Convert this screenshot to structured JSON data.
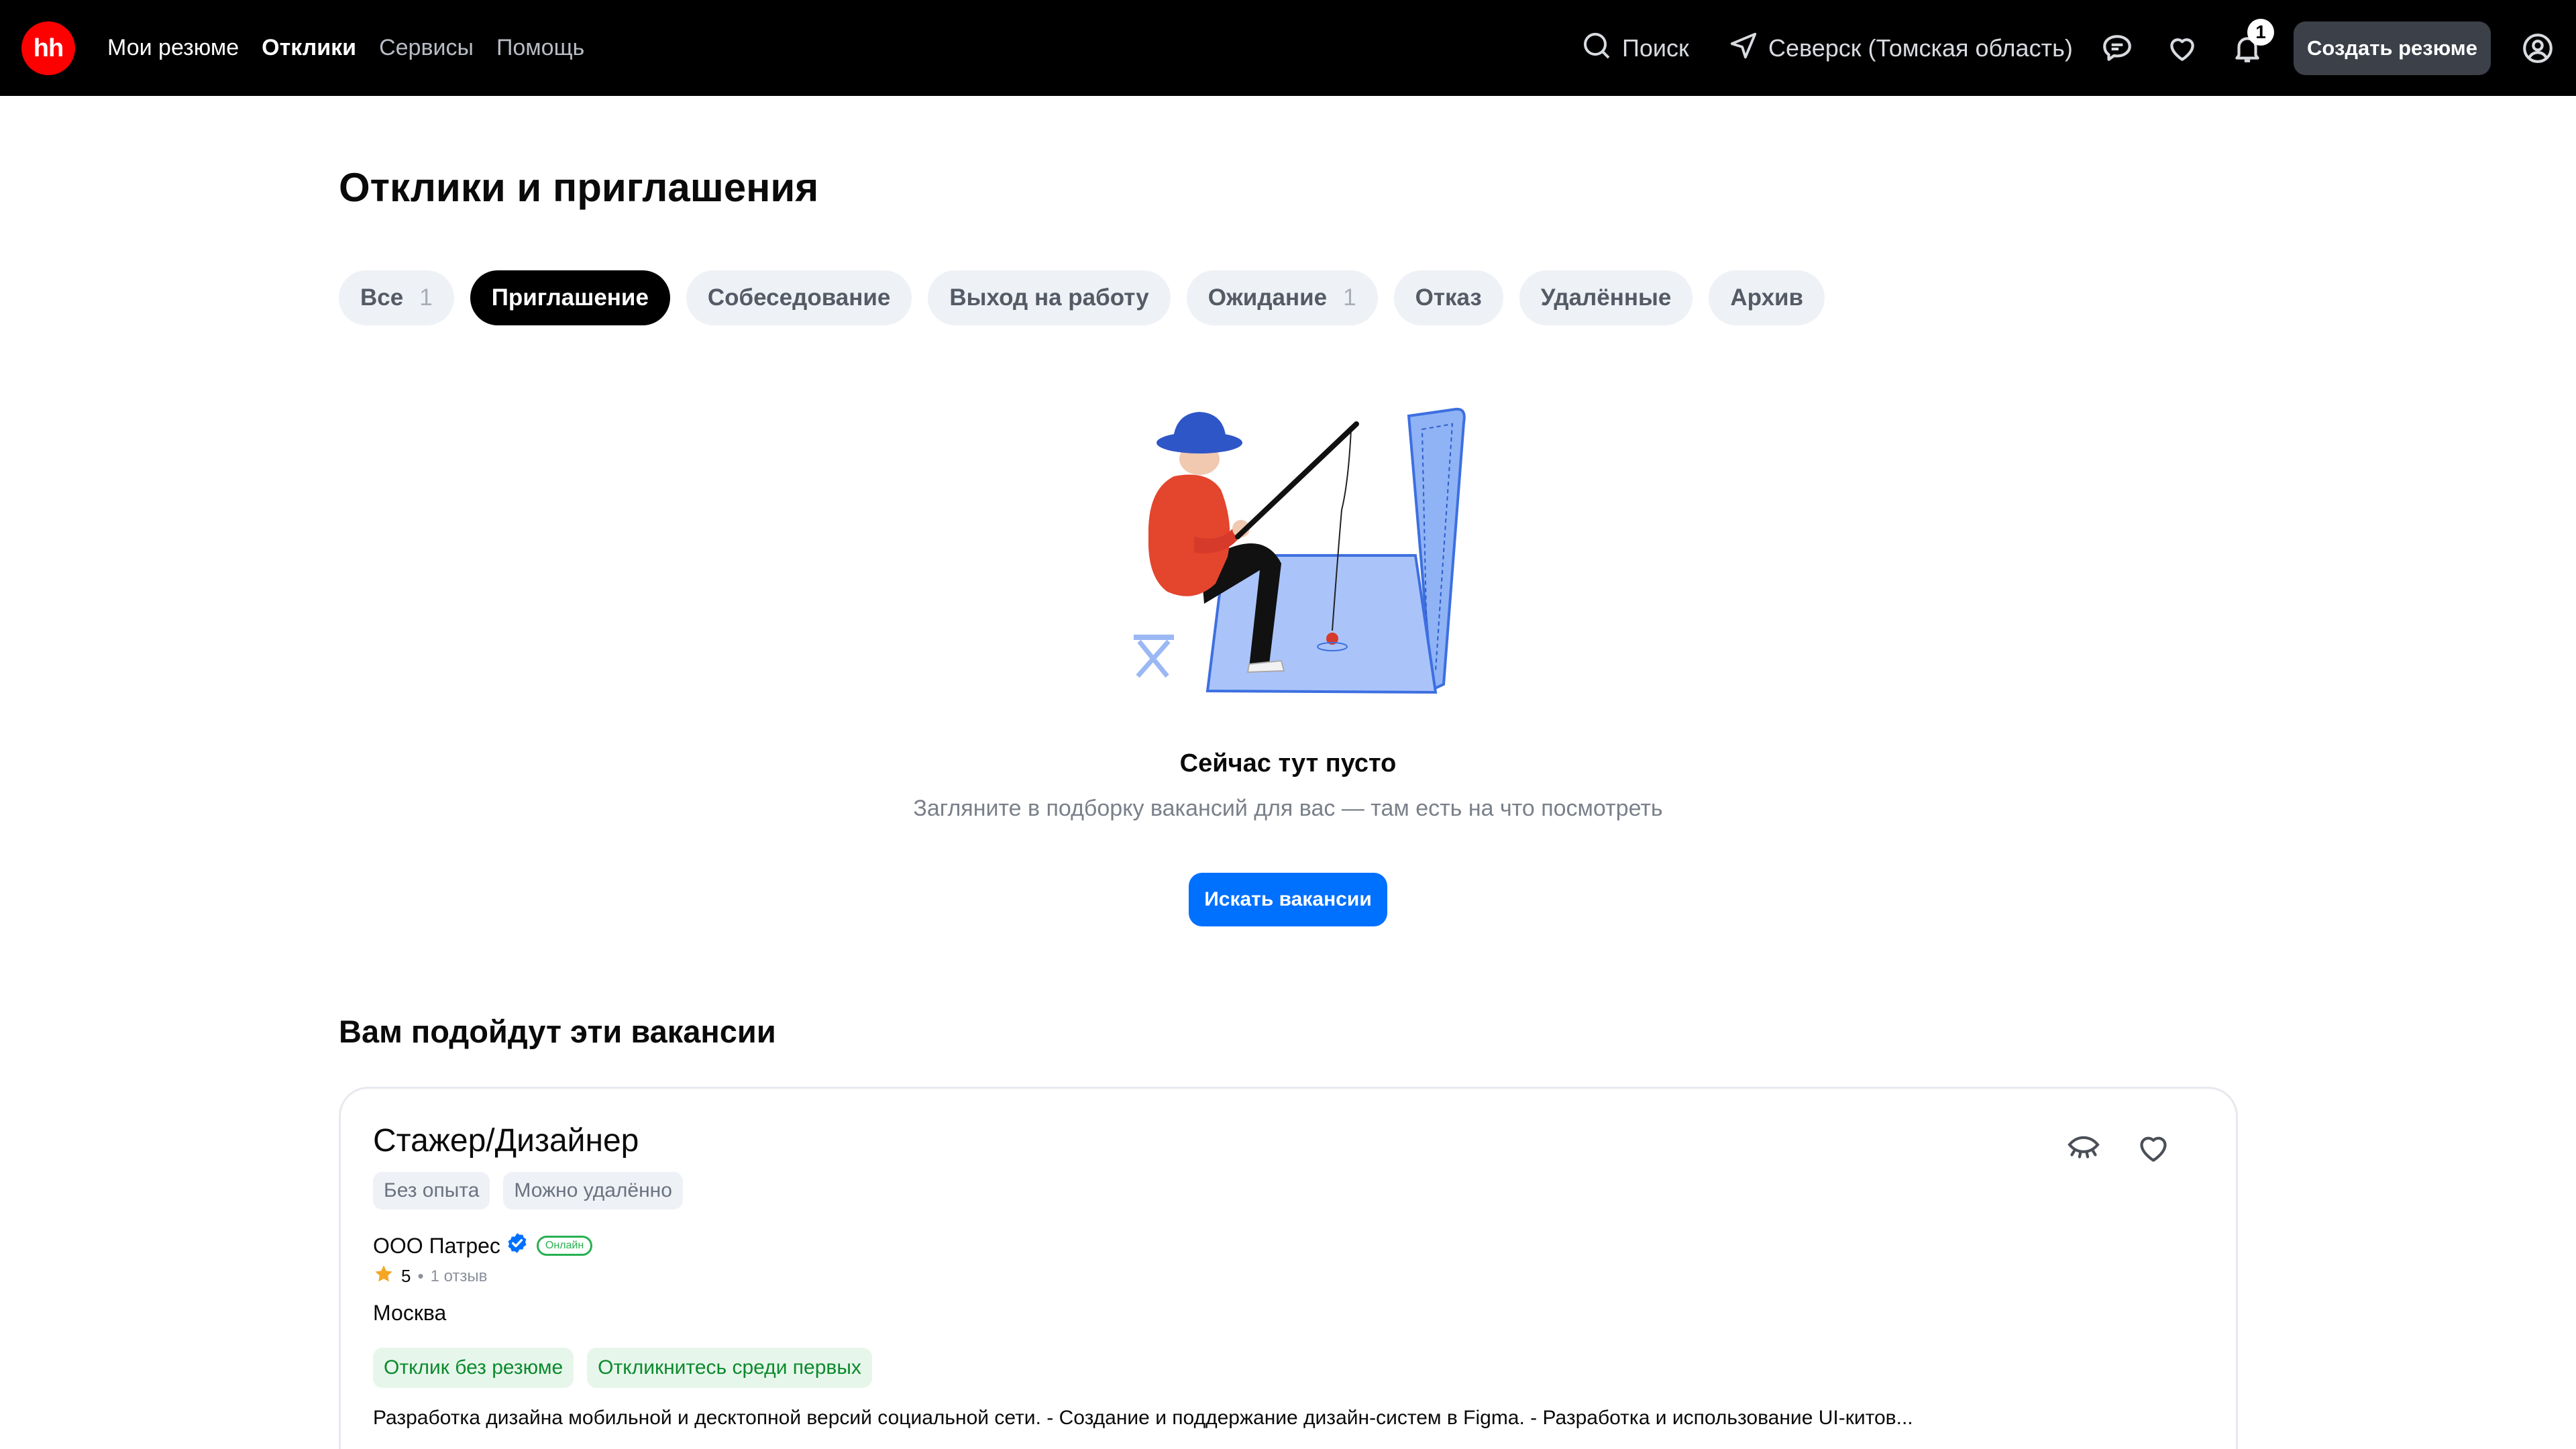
{
  "header": {
    "logo": "hh",
    "nav": [
      "Мои резюме",
      "Отклики",
      "Сервисы",
      "Помощь"
    ],
    "active_nav": "Отклики",
    "search_label": "Поиск",
    "location": "Северск (Томская область)",
    "notifications_count": "1",
    "create_resume_label": "Создать резюме"
  },
  "page": {
    "title": "Отклики и приглашения"
  },
  "tabs": [
    {
      "label": "Все",
      "count": "1"
    },
    {
      "label": "Приглашение",
      "count": ""
    },
    {
      "label": "Собеседование",
      "count": ""
    },
    {
      "label": "Выход на работу",
      "count": ""
    },
    {
      "label": "Ожидание",
      "count": "1"
    },
    {
      "label": "Отказ",
      "count": ""
    },
    {
      "label": "Удалённые",
      "count": ""
    },
    {
      "label": "Архив",
      "count": ""
    }
  ],
  "active_tab": "Приглашение",
  "empty_state": {
    "title": "Сейчас тут пусто",
    "subtitle": "Загляните в подборку вакансий для вас — там есть на что посмотреть",
    "button": "Искать вакансии"
  },
  "recommendations": {
    "title": "Вам подойдут эти вакансии",
    "vacancy": {
      "title": "Стажер/Дизайнер",
      "tags": [
        "Без опыта",
        "Можно удалённо"
      ],
      "company": "ООО Патрес",
      "online_badge": "Онлайн",
      "rating": "5",
      "reviews": "1 отзыв",
      "city": "Москва",
      "highlights": [
        "Отклик без резюме",
        "Откликнитесь среди первых"
      ],
      "description": "Разработка дизайна мобильной и десктопной версий социальной сети. - Создание и поддержание дизайн-систем в Figma. - Разработка и использование UI-китов..."
    }
  },
  "colors": {
    "brand_red": "#ff0000",
    "header_bg": "#000000",
    "primary_blue": "#0070ff",
    "success_green": "#0b8a2e",
    "star": "#f5a623"
  },
  "icons": [
    "search-icon",
    "location-arrow-icon",
    "chat-icon",
    "heart-icon",
    "bell-icon",
    "user-icon",
    "verified-icon",
    "star-icon",
    "eye-closed-icon"
  ]
}
